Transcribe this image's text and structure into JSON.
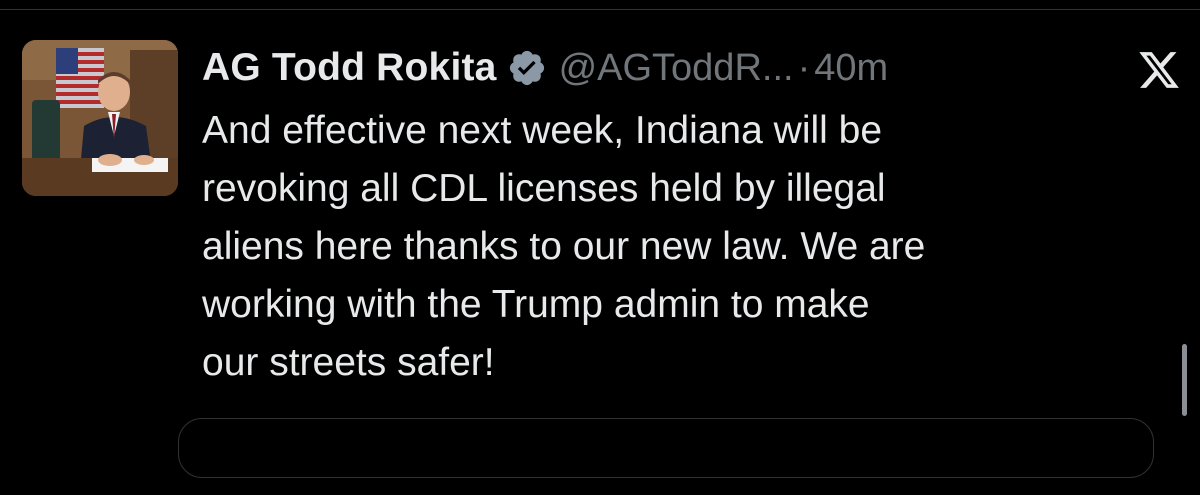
{
  "post": {
    "display_name": "AG Todd Rokita",
    "handle": "@AGToddR...",
    "separator": "·",
    "time": "40m",
    "text": "And effective next week, Indiana will be\nrevoking all CDL licenses held by illegal\naliens here thanks to our new law. We are\nworking with the Trump admin to make\nour streets safer!",
    "verified_icon": "verified-badge-icon",
    "platform_icon": "x-logo-icon"
  },
  "colors": {
    "background": "#000000",
    "primary_text": "#e7e9ea",
    "secondary_text": "#71767b",
    "divider": "#2f3336"
  }
}
